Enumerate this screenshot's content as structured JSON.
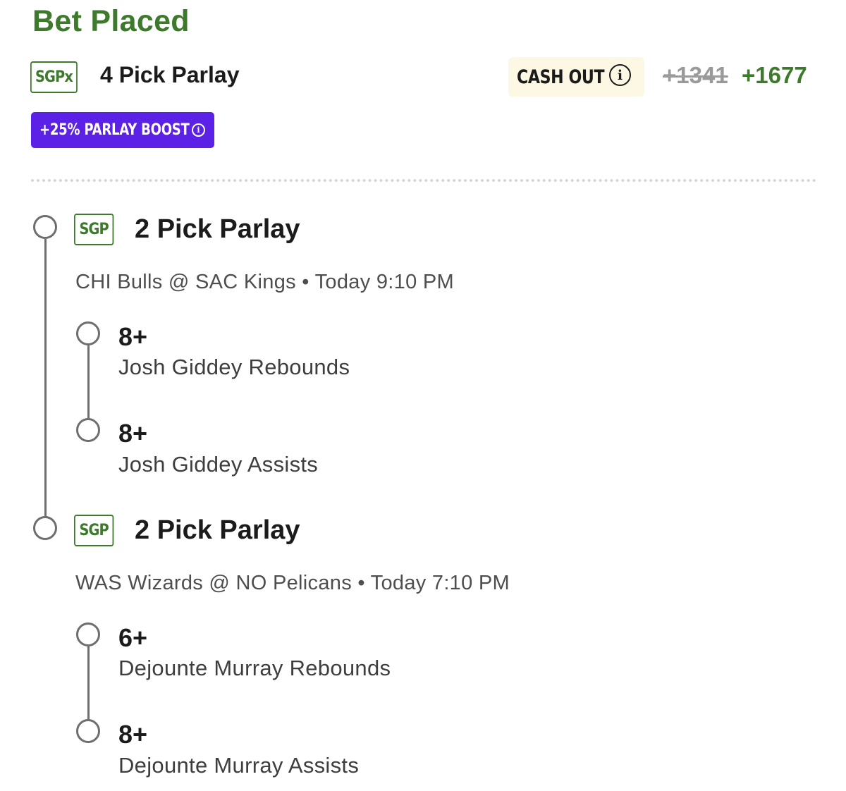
{
  "header": {
    "title": "Bet Placed",
    "bet_type_badge": "SGPx",
    "bet_name": "4 Pick Parlay",
    "cash_out_label": "CASH OUT",
    "odds_original": "+1341",
    "odds_boosted": "+1677",
    "boost_label": "+25% PARLAY BOOST"
  },
  "colors": {
    "brand_green": "#3d7a2c",
    "boost_purple": "#5b21e6",
    "cash_out_bg": "#fdf8e4"
  },
  "legs": [
    {
      "badge": "SGP",
      "title": "2 Pick Parlay",
      "game": "CHI Bulls @ SAC Kings",
      "time": "Today 9:10 PM",
      "picks": [
        {
          "line": "8+",
          "desc": "Josh Giddey Rebounds"
        },
        {
          "line": "8+",
          "desc": "Josh Giddey Assists"
        }
      ]
    },
    {
      "badge": "SGP",
      "title": "2 Pick Parlay",
      "game": "WAS Wizards @ NO Pelicans",
      "time": "Today 7:10 PM",
      "picks": [
        {
          "line": "6+",
          "desc": "Dejounte Murray Rebounds"
        },
        {
          "line": "8+",
          "desc": "Dejounte Murray Assists"
        }
      ]
    }
  ]
}
